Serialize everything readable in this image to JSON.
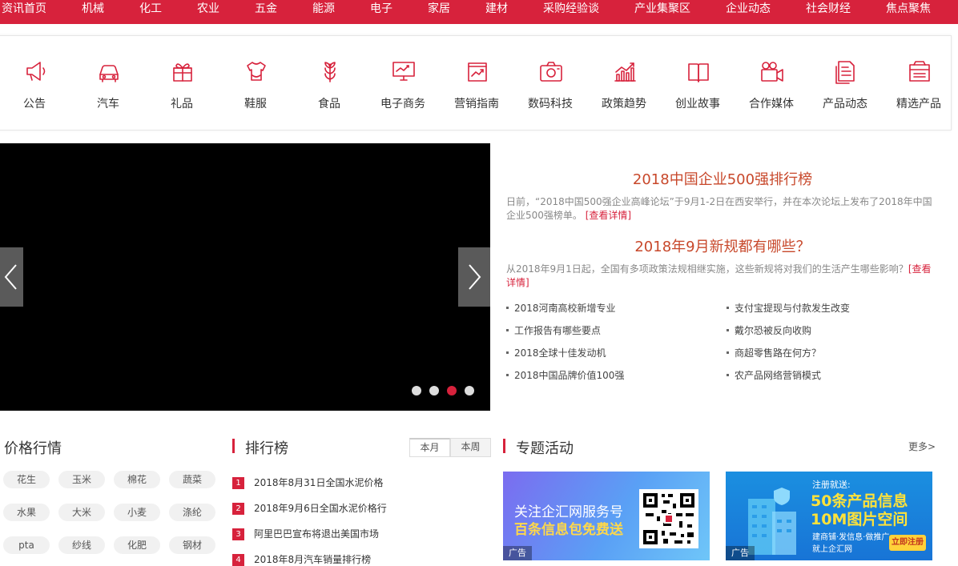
{
  "topnav": [
    "资讯首页",
    "机械",
    "化工",
    "农业",
    "五金",
    "能源",
    "电子",
    "家居",
    "建材",
    "采购经验谈",
    "产业集聚区",
    "企业动态",
    "社会财经",
    "焦点聚焦"
  ],
  "categories": [
    {
      "label": "公告",
      "icon": "megaphone-icon"
    },
    {
      "label": "汽车",
      "icon": "car-icon"
    },
    {
      "label": "礼品",
      "icon": "gift-icon"
    },
    {
      "label": "鞋服",
      "icon": "shirt-icon"
    },
    {
      "label": "食品",
      "icon": "wheat-icon"
    },
    {
      "label": "电子商务",
      "icon": "monitor-icon"
    },
    {
      "label": "营销指南",
      "icon": "chart-board-icon"
    },
    {
      "label": "数码科技",
      "icon": "camera-icon"
    },
    {
      "label": "政策趋势",
      "icon": "trend-icon"
    },
    {
      "label": "创业故事",
      "icon": "book-icon"
    },
    {
      "label": "合作媒体",
      "icon": "video-camera-icon"
    },
    {
      "label": "产品动态",
      "icon": "document-icon"
    },
    {
      "label": "精选产品",
      "icon": "box-icon"
    }
  ],
  "slider": {
    "active_dot": 3,
    "dot_count": 4
  },
  "news": {
    "headline1": "2018中国企业500强排行榜",
    "summary1": "日前，“2018中国500强企业高峰论坛”于9月1-2日在西安举行，并在本次论坛上发布了2018年中国企业500强榜单。",
    "link1": "[查看详情]",
    "headline2": "2018年9月新规都有哪些？",
    "summary2": "从2018年9月1日起，全国有多项政策法规相继实施，这些新规将对我们的生活产生哪些影响？",
    "link2": "[查看详情]",
    "links": [
      "2018河南高校新增专业",
      "支付宝提现与付款发生改变",
      "工作报告有哪些要点",
      "戴尔恐被反向收购",
      "2018全球十佳发动机",
      "商超零售路在何方？",
      "2018中国品牌价值100强",
      "农产品网络营销模式"
    ]
  },
  "prices": {
    "title": "价格行情",
    "items": [
      "花生",
      "玉米",
      "棉花",
      "蔬菜",
      "水果",
      "大米",
      "小麦",
      "涤纶",
      "pta",
      "纱线",
      "化肥",
      "钢材"
    ]
  },
  "ranking": {
    "title": "排行榜",
    "tab_month": "本月",
    "tab_week": "本周",
    "items": [
      {
        "num": "1",
        "text": "2018年8月31日全国水泥价格"
      },
      {
        "num": "2",
        "text": "2018年9月6日全国水泥价格行"
      },
      {
        "num": "3",
        "text": "阿里巴巴宣布将退出美国市场"
      },
      {
        "num": "4",
        "text": "2018年8月汽车销量排行榜"
      }
    ]
  },
  "special": {
    "title": "专题活动",
    "more": "更多>",
    "ad1": {
      "line1": "关注企汇网服务号",
      "line2": "百条信息包免费送",
      "tag": "广告"
    },
    "ad2": {
      "top": "注册就送:",
      "big1": "50条产品信息",
      "big2": "10M图片空间",
      "small": "建商铺·发信息·做推广",
      "small2": "就上企汇网",
      "btn": "立即注册",
      "tag": "广告"
    }
  },
  "colors": {
    "brand": "#d7223c",
    "headline": "#c8482b"
  }
}
